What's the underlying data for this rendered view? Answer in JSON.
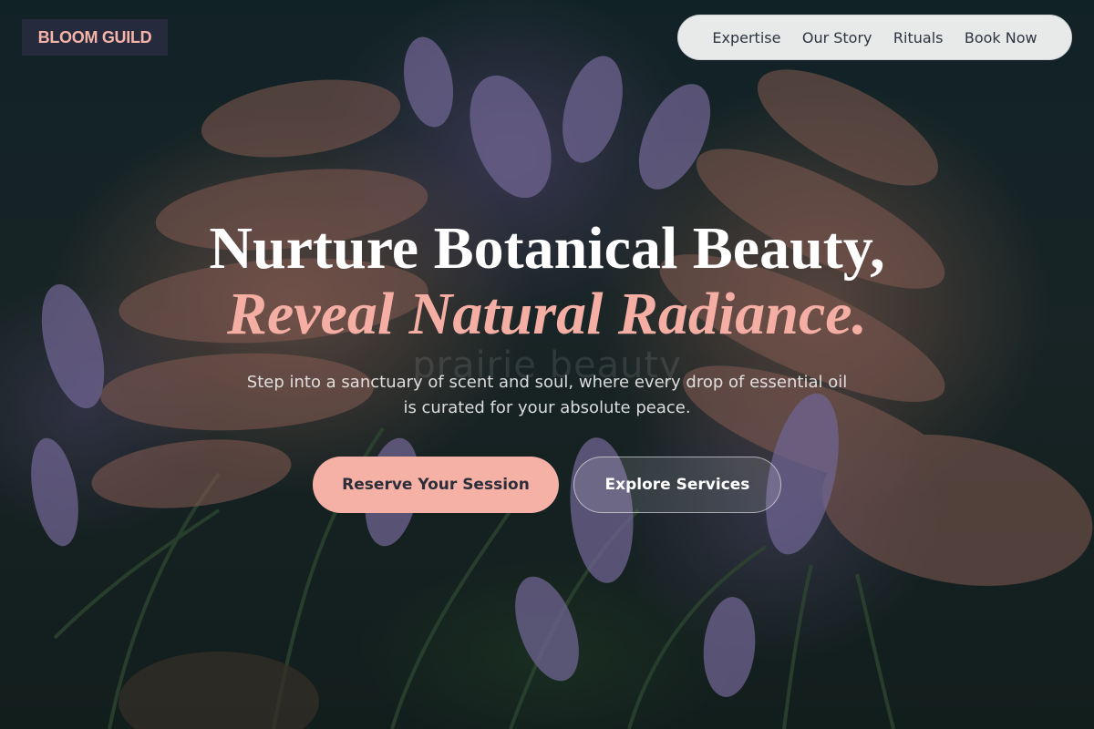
{
  "brand": {
    "name": "BLOOM GUILD"
  },
  "nav": {
    "items": [
      {
        "label": "Expertise"
      },
      {
        "label": "Our Story"
      },
      {
        "label": "Rituals"
      },
      {
        "label": "Book Now"
      }
    ]
  },
  "hero": {
    "headline_line1": "Nurture Botanical Beauty,",
    "headline_line2": "Reveal Natural Radiance.",
    "subtitle": "Step into a sanctuary of scent and soul, where every drop of essential oil is curated for your absolute peace.",
    "watermark": "prairie beauty",
    "background_image": "hands-with-lavender-photo"
  },
  "actions": {
    "primary_label": "Reserve Your Session",
    "secondary_label": "Explore Services"
  },
  "colors": {
    "accent": "#f6b1a6",
    "logo_bg": "#252b3d",
    "nav_bg": "#f4f4f4",
    "text_dark": "#2c2f3a"
  }
}
